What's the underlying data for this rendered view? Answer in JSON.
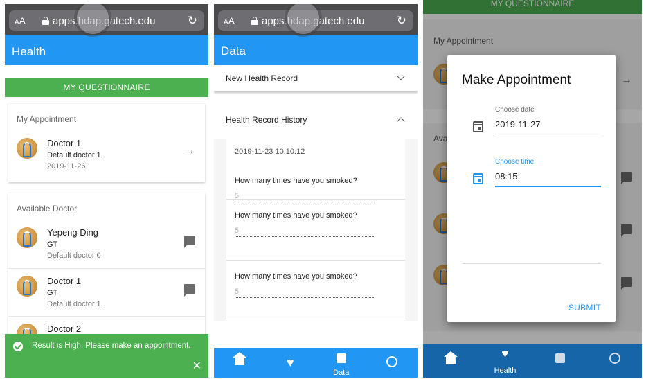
{
  "browser": {
    "text_size": "AA",
    "url": "apps.hdap.gatech.edu"
  },
  "screen1": {
    "app_title": "Health",
    "questionnaire_button": "MY QUESTIONNAIRE",
    "my_appointment": {
      "title": "My Appointment",
      "item": {
        "name": "Doctor 1",
        "desc": "Default doctor 1",
        "date": "2019-11-26"
      }
    },
    "available_doctor": {
      "title": "Available Doctor",
      "items": [
        {
          "name": "Yepeng Ding",
          "org": "GT",
          "desc": "Default doctor 0"
        },
        {
          "name": "Doctor 1",
          "org": "GT",
          "desc": "Default doctor 1"
        },
        {
          "name": "Doctor 2"
        }
      ]
    },
    "toast": {
      "message": "Result is High. Please make an appointment.",
      "close": "✕"
    }
  },
  "screen2": {
    "app_title": "Data",
    "panels": [
      {
        "label": "New Health Record"
      },
      {
        "label": "Health Record History"
      }
    ],
    "history": {
      "timestamp": "2019-11-23 10:10:12",
      "records": [
        {
          "question": "How many times have you smoked?",
          "answer": "5"
        },
        {
          "question": "How many times have you smoked?",
          "answer": "5"
        },
        {
          "question": "How many times have you smoked?",
          "answer": "5"
        }
      ]
    },
    "bottom_nav": {
      "active_label": "Data"
    }
  },
  "screen3": {
    "questionnaire_button": "MY QUESTIONNAIRE",
    "bg_my_appointment": "My Appointment",
    "bg_available": "Ava",
    "dialog": {
      "title": "Make Appointment",
      "date_label": "Choose date",
      "date_value": "2019-11-27",
      "time_label": "Choose time",
      "time_value": "08:15",
      "submit": "SUBMIT"
    },
    "bottom_nav": {
      "active_label": "Health"
    }
  },
  "colors": {
    "primary": "#2196f3",
    "success": "#4caf50"
  }
}
